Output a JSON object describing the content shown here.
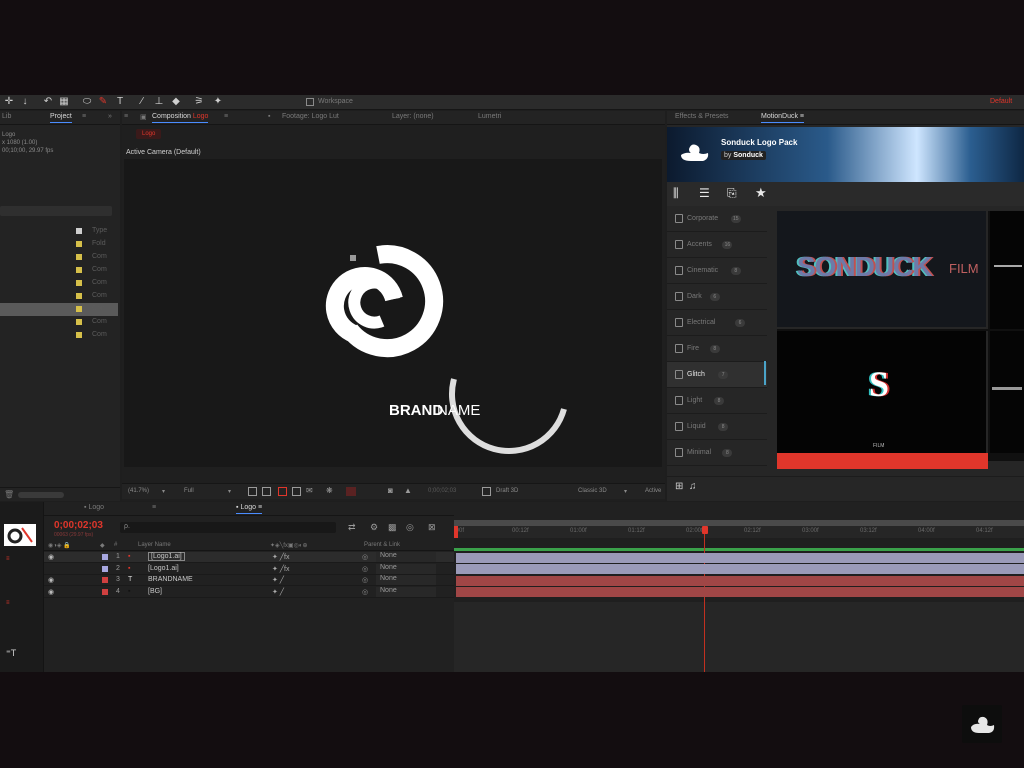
{
  "app": {
    "toolbar_center_label": "Workspace",
    "toolbar_right_label": "Default"
  },
  "project_panel": {
    "tab_left": "Lib",
    "tab_project": "Project",
    "info_lines": [
      "Logo",
      "x 1080 (1.00)",
      "00;10;00, 29.97 fps"
    ],
    "column_type": "Type",
    "rows": [
      {
        "type": "Type",
        "label": "Fold"
      },
      {
        "type": "Fold",
        "label": ""
      },
      {
        "type": "Com",
        "label": ""
      },
      {
        "type": "Com",
        "label": ""
      },
      {
        "type": "Com",
        "label": ""
      },
      {
        "type": "Com",
        "label": ""
      },
      {
        "type": "Com",
        "label": ""
      },
      {
        "type": "Com",
        "label": ""
      },
      {
        "type": "Com",
        "label": ""
      }
    ]
  },
  "comp_panel": {
    "tab_comp": "Composition",
    "tab_comp_name": "Logo",
    "tab_footage": "Footage: Logo Lut",
    "tab_layer": "Layer: (none)",
    "tab_lumetri": "Lumetri",
    "sub_tab": "Logo",
    "camera_label": "Active Camera (Default)",
    "brand_bold": "BRAND",
    "brand_light": "NAME",
    "zoom": "(41.7%)",
    "resolution": "Full",
    "timecode": "0;00;02;03",
    "draft": "Draft 3D",
    "renderer": "Classic 3D",
    "view": "Active"
  },
  "motionduck": {
    "tab_effects": "Effects & Presets",
    "tab_md": "MotionDuck",
    "pack_title": "Sonduck Logo Pack",
    "pack_by": "by",
    "pack_author": "Sonduck",
    "categories": [
      {
        "label": "Corporate",
        "count": "15"
      },
      {
        "label": "Accents",
        "count": "16"
      },
      {
        "label": "Cinematic",
        "count": "8"
      },
      {
        "label": "Dark",
        "count": "6"
      },
      {
        "label": "Electrical",
        "count": "6"
      },
      {
        "label": "Fire",
        "count": "8"
      },
      {
        "label": "Glitch",
        "count": "7"
      },
      {
        "label": "Light",
        "count": "8"
      },
      {
        "label": "Liquid",
        "count": "8"
      },
      {
        "label": "Minimal",
        "count": "8"
      }
    ],
    "selected_category": "Glitch",
    "preview1_text_a": "SONDUCK",
    "preview1_text_b": "FILM",
    "preview2_letter": "S",
    "preview2_small": "FILM"
  },
  "timeline": {
    "tab1": "Logo",
    "tab2": "Logo",
    "timecode": "0;00;02;03",
    "timecode_sub": "00063 (29.97 fps)",
    "search_placeholder": "ρ.",
    "col_layer_name": "Layer Name",
    "col_parent": "Parent & Link",
    "layers": [
      {
        "num": "1",
        "name": "[Logo1.ai]",
        "parent": "None",
        "color": "#a8a8e0",
        "kind": "ai"
      },
      {
        "num": "2",
        "name": "[Logo1.ai]",
        "parent": "None",
        "color": "#a8a8e0",
        "kind": "ai"
      },
      {
        "num": "3",
        "name": "BRANDNAME",
        "parent": "None",
        "color": "#d04040",
        "kind": "T"
      },
      {
        "num": "4",
        "name": "[BG]",
        "parent": "None",
        "color": "#d04040",
        "kind": "bg"
      }
    ],
    "ruler": [
      ":00f",
      "00:12f",
      "01:00f",
      "01:12f",
      "02:00f",
      "02:12f",
      "03:00f",
      "03:12f",
      "04:00f",
      "04:12f"
    ]
  },
  "colors": {
    "accent_red": "#e0362b",
    "layer_lavender": "#a8a8e0",
    "layer_red": "#b04848"
  }
}
